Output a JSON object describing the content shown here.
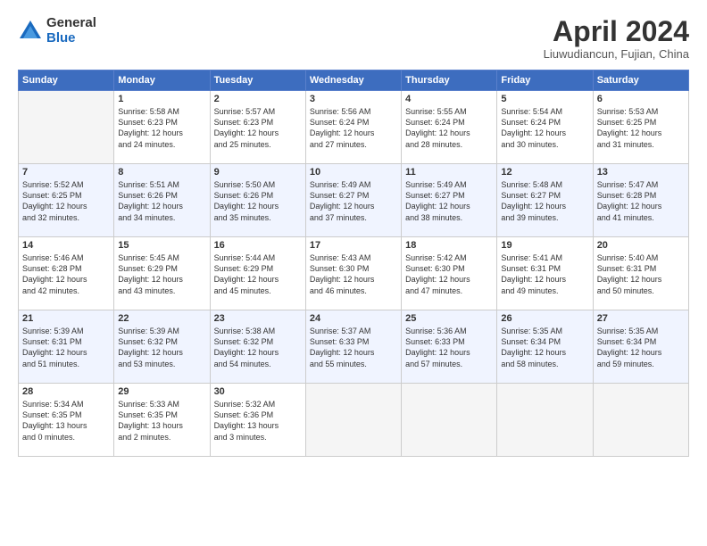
{
  "logo": {
    "general": "General",
    "blue": "Blue"
  },
  "header": {
    "title": "April 2024",
    "subtitle": "Liuwudiancun, Fujian, China"
  },
  "weekdays": [
    "Sunday",
    "Monday",
    "Tuesday",
    "Wednesday",
    "Thursday",
    "Friday",
    "Saturday"
  ],
  "weeks": [
    [
      {
        "day": "",
        "text": ""
      },
      {
        "day": "1",
        "text": "Sunrise: 5:58 AM\nSunset: 6:23 PM\nDaylight: 12 hours\nand 24 minutes."
      },
      {
        "day": "2",
        "text": "Sunrise: 5:57 AM\nSunset: 6:23 PM\nDaylight: 12 hours\nand 25 minutes."
      },
      {
        "day": "3",
        "text": "Sunrise: 5:56 AM\nSunset: 6:24 PM\nDaylight: 12 hours\nand 27 minutes."
      },
      {
        "day": "4",
        "text": "Sunrise: 5:55 AM\nSunset: 6:24 PM\nDaylight: 12 hours\nand 28 minutes."
      },
      {
        "day": "5",
        "text": "Sunrise: 5:54 AM\nSunset: 6:24 PM\nDaylight: 12 hours\nand 30 minutes."
      },
      {
        "day": "6",
        "text": "Sunrise: 5:53 AM\nSunset: 6:25 PM\nDaylight: 12 hours\nand 31 minutes."
      }
    ],
    [
      {
        "day": "7",
        "text": "Sunrise: 5:52 AM\nSunset: 6:25 PM\nDaylight: 12 hours\nand 32 minutes."
      },
      {
        "day": "8",
        "text": "Sunrise: 5:51 AM\nSunset: 6:26 PM\nDaylight: 12 hours\nand 34 minutes."
      },
      {
        "day": "9",
        "text": "Sunrise: 5:50 AM\nSunset: 6:26 PM\nDaylight: 12 hours\nand 35 minutes."
      },
      {
        "day": "10",
        "text": "Sunrise: 5:49 AM\nSunset: 6:27 PM\nDaylight: 12 hours\nand 37 minutes."
      },
      {
        "day": "11",
        "text": "Sunrise: 5:49 AM\nSunset: 6:27 PM\nDaylight: 12 hours\nand 38 minutes."
      },
      {
        "day": "12",
        "text": "Sunrise: 5:48 AM\nSunset: 6:27 PM\nDaylight: 12 hours\nand 39 minutes."
      },
      {
        "day": "13",
        "text": "Sunrise: 5:47 AM\nSunset: 6:28 PM\nDaylight: 12 hours\nand 41 minutes."
      }
    ],
    [
      {
        "day": "14",
        "text": "Sunrise: 5:46 AM\nSunset: 6:28 PM\nDaylight: 12 hours\nand 42 minutes."
      },
      {
        "day": "15",
        "text": "Sunrise: 5:45 AM\nSunset: 6:29 PM\nDaylight: 12 hours\nand 43 minutes."
      },
      {
        "day": "16",
        "text": "Sunrise: 5:44 AM\nSunset: 6:29 PM\nDaylight: 12 hours\nand 45 minutes."
      },
      {
        "day": "17",
        "text": "Sunrise: 5:43 AM\nSunset: 6:30 PM\nDaylight: 12 hours\nand 46 minutes."
      },
      {
        "day": "18",
        "text": "Sunrise: 5:42 AM\nSunset: 6:30 PM\nDaylight: 12 hours\nand 47 minutes."
      },
      {
        "day": "19",
        "text": "Sunrise: 5:41 AM\nSunset: 6:31 PM\nDaylight: 12 hours\nand 49 minutes."
      },
      {
        "day": "20",
        "text": "Sunrise: 5:40 AM\nSunset: 6:31 PM\nDaylight: 12 hours\nand 50 minutes."
      }
    ],
    [
      {
        "day": "21",
        "text": "Sunrise: 5:39 AM\nSunset: 6:31 PM\nDaylight: 12 hours\nand 51 minutes."
      },
      {
        "day": "22",
        "text": "Sunrise: 5:39 AM\nSunset: 6:32 PM\nDaylight: 12 hours\nand 53 minutes."
      },
      {
        "day": "23",
        "text": "Sunrise: 5:38 AM\nSunset: 6:32 PM\nDaylight: 12 hours\nand 54 minutes."
      },
      {
        "day": "24",
        "text": "Sunrise: 5:37 AM\nSunset: 6:33 PM\nDaylight: 12 hours\nand 55 minutes."
      },
      {
        "day": "25",
        "text": "Sunrise: 5:36 AM\nSunset: 6:33 PM\nDaylight: 12 hours\nand 57 minutes."
      },
      {
        "day": "26",
        "text": "Sunrise: 5:35 AM\nSunset: 6:34 PM\nDaylight: 12 hours\nand 58 minutes."
      },
      {
        "day": "27",
        "text": "Sunrise: 5:35 AM\nSunset: 6:34 PM\nDaylight: 12 hours\nand 59 minutes."
      }
    ],
    [
      {
        "day": "28",
        "text": "Sunrise: 5:34 AM\nSunset: 6:35 PM\nDaylight: 13 hours\nand 0 minutes."
      },
      {
        "day": "29",
        "text": "Sunrise: 5:33 AM\nSunset: 6:35 PM\nDaylight: 13 hours\nand 2 minutes."
      },
      {
        "day": "30",
        "text": "Sunrise: 5:32 AM\nSunset: 6:36 PM\nDaylight: 13 hours\nand 3 minutes."
      },
      {
        "day": "",
        "text": ""
      },
      {
        "day": "",
        "text": ""
      },
      {
        "day": "",
        "text": ""
      },
      {
        "day": "",
        "text": ""
      }
    ]
  ]
}
